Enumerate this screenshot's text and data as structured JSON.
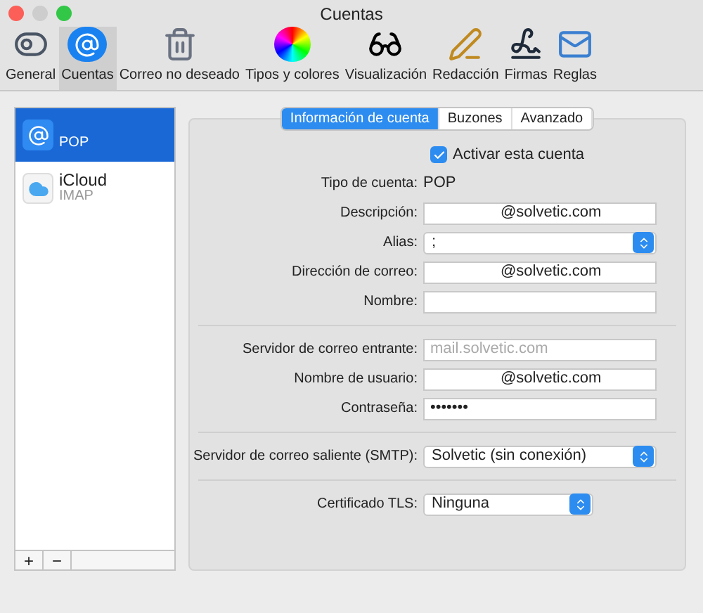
{
  "window": {
    "title": "Cuentas"
  },
  "toolbar": [
    {
      "label": "General",
      "selected": false
    },
    {
      "label": "Cuentas",
      "selected": true
    },
    {
      "label": "Correo no deseado",
      "selected": false
    },
    {
      "label": "Tipos y colores",
      "selected": false
    },
    {
      "label": "Visualización",
      "selected": false
    },
    {
      "label": "Redacción",
      "selected": false
    },
    {
      "label": "Firmas",
      "selected": false
    },
    {
      "label": "Reglas",
      "selected": false
    }
  ],
  "accounts": [
    {
      "type": "POP",
      "selected": true
    },
    {
      "name": "iCloud",
      "type": "IMAP",
      "selected": false
    }
  ],
  "list_buttons": [
    "+",
    "−"
  ],
  "tabs": [
    {
      "label": "Información de cuenta",
      "selected": true
    },
    {
      "label": "Buzones",
      "selected": false
    },
    {
      "label": "Avanzado",
      "selected": false
    }
  ],
  "form": [
    {
      "kind": "checkbox",
      "label": "Activar esta cuenta",
      "checked": true
    },
    {
      "kind": "text",
      "label": "Tipo de cuenta:",
      "value": "POP"
    },
    {
      "kind": "input",
      "label": "Descripción:",
      "value": "@solvetic.com"
    },
    {
      "kind": "select",
      "label": "Alias:",
      "value": ";"
    },
    {
      "kind": "input",
      "label": "Dirección de correo:",
      "value": "@solvetic.com"
    },
    {
      "kind": "input",
      "label": "Nombre:"
    },
    {
      "kind": "separator"
    },
    {
      "kind": "input",
      "label": "Servidor de correo entrante:",
      "placeholder": "mail.solvetic.com"
    },
    {
      "kind": "input",
      "label": "Nombre de usuario:",
      "value": "@solvetic.com"
    },
    {
      "kind": "input",
      "label": "Contraseña:",
      "value": "•••••••"
    },
    {
      "kind": "separator"
    },
    {
      "kind": "select",
      "label": "Servidor de correo saliente (SMTP):",
      "value": "Solvetic (sin conexión)"
    },
    {
      "kind": "separator"
    },
    {
      "kind": "select",
      "label": "Certificado TLS:",
      "value": "Ninguna",
      "short": true
    }
  ]
}
